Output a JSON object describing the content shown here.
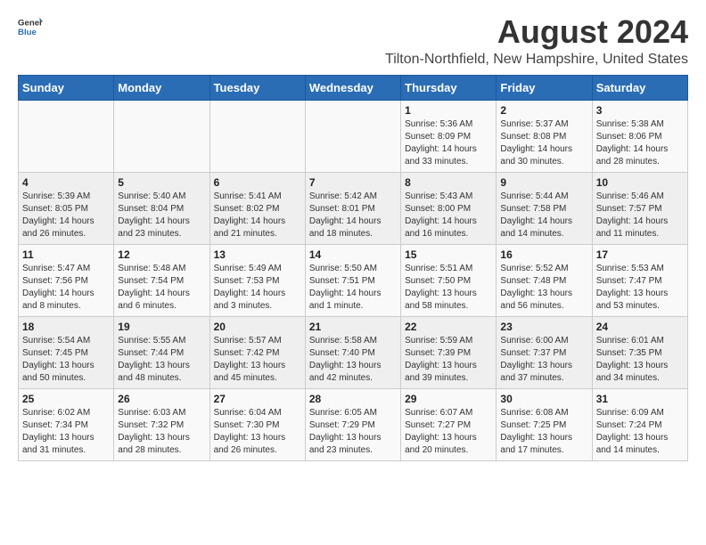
{
  "header": {
    "logo_general": "General",
    "logo_blue": "Blue",
    "main_title": "August 2024",
    "subtitle": "Tilton-Northfield, New Hampshire, United States"
  },
  "days_of_week": [
    "Sunday",
    "Monday",
    "Tuesday",
    "Wednesday",
    "Thursday",
    "Friday",
    "Saturday"
  ],
  "weeks": [
    [
      {
        "day": "",
        "info": ""
      },
      {
        "day": "",
        "info": ""
      },
      {
        "day": "",
        "info": ""
      },
      {
        "day": "",
        "info": ""
      },
      {
        "day": "1",
        "info": "Sunrise: 5:36 AM\nSunset: 8:09 PM\nDaylight: 14 hours and 33 minutes."
      },
      {
        "day": "2",
        "info": "Sunrise: 5:37 AM\nSunset: 8:08 PM\nDaylight: 14 hours and 30 minutes."
      },
      {
        "day": "3",
        "info": "Sunrise: 5:38 AM\nSunset: 8:06 PM\nDaylight: 14 hours and 28 minutes."
      }
    ],
    [
      {
        "day": "4",
        "info": "Sunrise: 5:39 AM\nSunset: 8:05 PM\nDaylight: 14 hours and 26 minutes."
      },
      {
        "day": "5",
        "info": "Sunrise: 5:40 AM\nSunset: 8:04 PM\nDaylight: 14 hours and 23 minutes."
      },
      {
        "day": "6",
        "info": "Sunrise: 5:41 AM\nSunset: 8:02 PM\nDaylight: 14 hours and 21 minutes."
      },
      {
        "day": "7",
        "info": "Sunrise: 5:42 AM\nSunset: 8:01 PM\nDaylight: 14 hours and 18 minutes."
      },
      {
        "day": "8",
        "info": "Sunrise: 5:43 AM\nSunset: 8:00 PM\nDaylight: 14 hours and 16 minutes."
      },
      {
        "day": "9",
        "info": "Sunrise: 5:44 AM\nSunset: 7:58 PM\nDaylight: 14 hours and 14 minutes."
      },
      {
        "day": "10",
        "info": "Sunrise: 5:46 AM\nSunset: 7:57 PM\nDaylight: 14 hours and 11 minutes."
      }
    ],
    [
      {
        "day": "11",
        "info": "Sunrise: 5:47 AM\nSunset: 7:56 PM\nDaylight: 14 hours and 8 minutes."
      },
      {
        "day": "12",
        "info": "Sunrise: 5:48 AM\nSunset: 7:54 PM\nDaylight: 14 hours and 6 minutes."
      },
      {
        "day": "13",
        "info": "Sunrise: 5:49 AM\nSunset: 7:53 PM\nDaylight: 14 hours and 3 minutes."
      },
      {
        "day": "14",
        "info": "Sunrise: 5:50 AM\nSunset: 7:51 PM\nDaylight: 14 hours and 1 minute."
      },
      {
        "day": "15",
        "info": "Sunrise: 5:51 AM\nSunset: 7:50 PM\nDaylight: 13 hours and 58 minutes."
      },
      {
        "day": "16",
        "info": "Sunrise: 5:52 AM\nSunset: 7:48 PM\nDaylight: 13 hours and 56 minutes."
      },
      {
        "day": "17",
        "info": "Sunrise: 5:53 AM\nSunset: 7:47 PM\nDaylight: 13 hours and 53 minutes."
      }
    ],
    [
      {
        "day": "18",
        "info": "Sunrise: 5:54 AM\nSunset: 7:45 PM\nDaylight: 13 hours and 50 minutes."
      },
      {
        "day": "19",
        "info": "Sunrise: 5:55 AM\nSunset: 7:44 PM\nDaylight: 13 hours and 48 minutes."
      },
      {
        "day": "20",
        "info": "Sunrise: 5:57 AM\nSunset: 7:42 PM\nDaylight: 13 hours and 45 minutes."
      },
      {
        "day": "21",
        "info": "Sunrise: 5:58 AM\nSunset: 7:40 PM\nDaylight: 13 hours and 42 minutes."
      },
      {
        "day": "22",
        "info": "Sunrise: 5:59 AM\nSunset: 7:39 PM\nDaylight: 13 hours and 39 minutes."
      },
      {
        "day": "23",
        "info": "Sunrise: 6:00 AM\nSunset: 7:37 PM\nDaylight: 13 hours and 37 minutes."
      },
      {
        "day": "24",
        "info": "Sunrise: 6:01 AM\nSunset: 7:35 PM\nDaylight: 13 hours and 34 minutes."
      }
    ],
    [
      {
        "day": "25",
        "info": "Sunrise: 6:02 AM\nSunset: 7:34 PM\nDaylight: 13 hours and 31 minutes."
      },
      {
        "day": "26",
        "info": "Sunrise: 6:03 AM\nSunset: 7:32 PM\nDaylight: 13 hours and 28 minutes."
      },
      {
        "day": "27",
        "info": "Sunrise: 6:04 AM\nSunset: 7:30 PM\nDaylight: 13 hours and 26 minutes."
      },
      {
        "day": "28",
        "info": "Sunrise: 6:05 AM\nSunset: 7:29 PM\nDaylight: 13 hours and 23 minutes."
      },
      {
        "day": "29",
        "info": "Sunrise: 6:07 AM\nSunset: 7:27 PM\nDaylight: 13 hours and 20 minutes."
      },
      {
        "day": "30",
        "info": "Sunrise: 6:08 AM\nSunset: 7:25 PM\nDaylight: 13 hours and 17 minutes."
      },
      {
        "day": "31",
        "info": "Sunrise: 6:09 AM\nSunset: 7:24 PM\nDaylight: 13 hours and 14 minutes."
      }
    ]
  ]
}
